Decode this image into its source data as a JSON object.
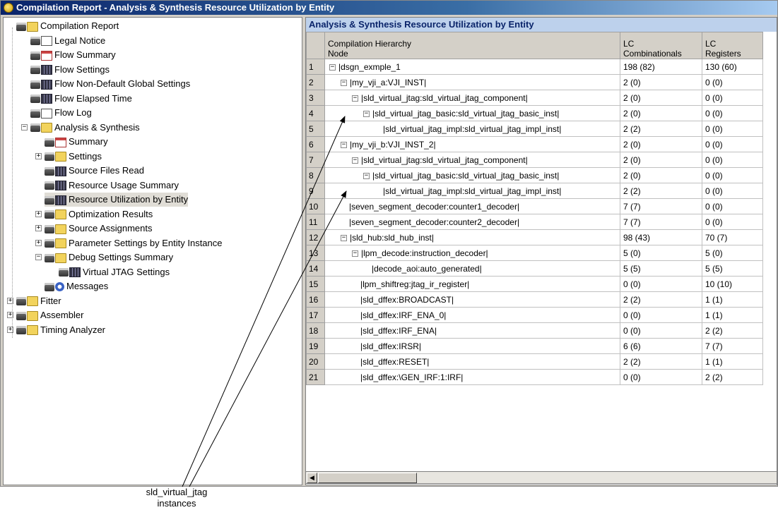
{
  "window": {
    "title": "Compilation Report - Analysis & Synthesis Resource Utilization by Entity"
  },
  "tree": [
    {
      "label": "Compilation Report",
      "icon": "folder-icon"
    },
    {
      "label": "Legal Notice",
      "icon": "document-icon"
    },
    {
      "label": "Flow Summary",
      "icon": "table-icon"
    },
    {
      "label": "Flow Settings",
      "icon": "table-icon"
    },
    {
      "label": "Flow Non-Default Global Settings",
      "icon": "table-icon"
    },
    {
      "label": "Flow Elapsed Time",
      "icon": "table-icon"
    },
    {
      "label": "Flow Log",
      "icon": "document-icon"
    },
    {
      "label": "Analysis & Synthesis",
      "icon": "folder-icon"
    },
    {
      "label": "Summary",
      "icon": "table-icon"
    },
    {
      "label": "Settings",
      "icon": "folder-icon"
    },
    {
      "label": "Source Files Read",
      "icon": "table-icon"
    },
    {
      "label": "Resource Usage Summary",
      "icon": "table-icon"
    },
    {
      "label": "Resource Utilization by Entity",
      "icon": "table-icon"
    },
    {
      "label": "Optimization Results",
      "icon": "folder-icon"
    },
    {
      "label": "Source Assignments",
      "icon": "folder-icon"
    },
    {
      "label": "Parameter Settings by Entity Instance",
      "icon": "folder-icon"
    },
    {
      "label": "Debug Settings Summary",
      "icon": "folder-icon"
    },
    {
      "label": "Virtual JTAG Settings",
      "icon": "table-icon"
    },
    {
      "label": "Messages",
      "icon": "info-icon"
    },
    {
      "label": "Fitter",
      "icon": "folder-icon"
    },
    {
      "label": "Assembler",
      "icon": "folder-icon"
    },
    {
      "label": "Timing Analyzer",
      "icon": "folder-icon"
    }
  ],
  "panel": {
    "title": "Analysis & Synthesis Resource Utilization by Entity"
  },
  "table": {
    "headers": {
      "node_line1": "Compilation Hierarchy",
      "node_line2": "Node",
      "c1_line1": "LC",
      "c1_line2": "Combinationals",
      "c2_line1": "LC",
      "c2_line2": "Registers"
    },
    "rows": [
      {
        "num": "1",
        "node": "|dsgn_exmple_1",
        "c1": "198 (82)",
        "c2": "130 (60)"
      },
      {
        "num": "2",
        "node": "|my_vji_a:VJI_INST|",
        "c1": "2 (0)",
        "c2": "0 (0)"
      },
      {
        "num": "3",
        "node": "|sld_virtual_jtag:sld_virtual_jtag_component|",
        "c1": "2 (0)",
        "c2": "0 (0)"
      },
      {
        "num": "4",
        "node": "|sld_virtual_jtag_basic:sld_virtual_jtag_basic_inst|",
        "c1": "2 (0)",
        "c2": "0 (0)"
      },
      {
        "num": "5",
        "node": "|sld_virtual_jtag_impl:sld_virtual_jtag_impl_inst|",
        "c1": "2 (2)",
        "c2": "0 (0)"
      },
      {
        "num": "6",
        "node": "|my_vji_b:VJI_INST_2|",
        "c1": "2 (0)",
        "c2": "0 (0)"
      },
      {
        "num": "7",
        "node": "|sld_virtual_jtag:sld_virtual_jtag_component|",
        "c1": "2 (0)",
        "c2": "0 (0)"
      },
      {
        "num": "8",
        "node": "|sld_virtual_jtag_basic:sld_virtual_jtag_basic_inst|",
        "c1": "2 (0)",
        "c2": "0 (0)"
      },
      {
        "num": "9",
        "node": "|sld_virtual_jtag_impl:sld_virtual_jtag_impl_inst|",
        "c1": "2 (2)",
        "c2": "0 (0)"
      },
      {
        "num": "10",
        "node": "|seven_segment_decoder:counter1_decoder|",
        "c1": "7 (7)",
        "c2": "0 (0)"
      },
      {
        "num": "11",
        "node": "|seven_segment_decoder:counter2_decoder|",
        "c1": "7 (7)",
        "c2": "0 (0)"
      },
      {
        "num": "12",
        "node": "|sld_hub:sld_hub_inst|",
        "c1": "98 (43)",
        "c2": "70 (7)"
      },
      {
        "num": "13",
        "node": "|lpm_decode:instruction_decoder|",
        "c1": "5 (0)",
        "c2": "5 (0)"
      },
      {
        "num": "14",
        "node": "|decode_aoi:auto_generated|",
        "c1": "5 (5)",
        "c2": "5 (5)"
      },
      {
        "num": "15",
        "node": "|lpm_shiftreg:jtag_ir_register|",
        "c1": "0 (0)",
        "c2": "10 (10)"
      },
      {
        "num": "16",
        "node": "|sld_dffex:BROADCAST|",
        "c1": "2 (2)",
        "c2": "1 (1)"
      },
      {
        "num": "17",
        "node": "|sld_dffex:IRF_ENA_0|",
        "c1": "0 (0)",
        "c2": "1 (1)"
      },
      {
        "num": "18",
        "node": "|sld_dffex:IRF_ENA|",
        "c1": "0 (0)",
        "c2": "2 (2)"
      },
      {
        "num": "19",
        "node": "|sld_dffex:IRSR|",
        "c1": "6 (6)",
        "c2": "7 (7)"
      },
      {
        "num": "20",
        "node": "|sld_dffex:RESET|",
        "c1": "2 (2)",
        "c2": "1 (1)"
      },
      {
        "num": "21",
        "node": "|sld_dffex:\\GEN_IRF:1:IRF|",
        "c1": "0 (0)",
        "c2": "2 (2)"
      }
    ]
  },
  "annotation": {
    "line1": "sld_virtual_jtag",
    "line2": "instances"
  },
  "colors": {
    "title_start": "#0a246a",
    "panel_header": "#bdd1ec",
    "panel_title_text": "#0a246a"
  }
}
